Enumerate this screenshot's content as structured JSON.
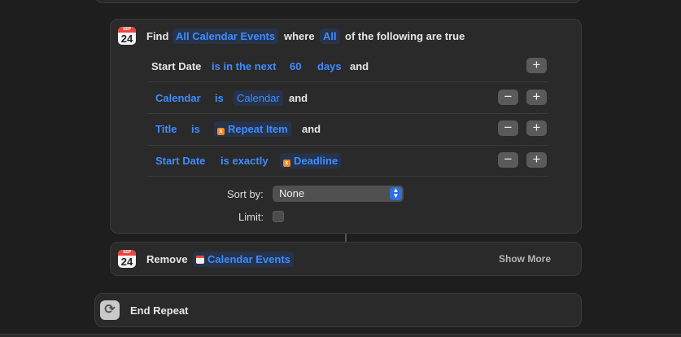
{
  "find_action": {
    "calendar_icon": {
      "month": "SEP",
      "day": "24"
    },
    "find_label": "Find",
    "source": "All Calendar Events",
    "where_label": "where",
    "match_mode": "All",
    "match_suffix": "of the following are true",
    "conditions": [
      {
        "field": "Start Date",
        "operator": "is in the next",
        "value": "60",
        "unit": "days",
        "joiner": "and"
      },
      {
        "field": "Calendar",
        "operator": "is",
        "value": "Calendar",
        "joiner": "and"
      },
      {
        "field": "Title",
        "operator": "is",
        "value": "Repeat Item",
        "value_icon": "variable-icon",
        "joiner": "and"
      },
      {
        "field": "Start Date",
        "operator": "is exactly",
        "value": "Deadline",
        "value_icon": "variable-icon"
      }
    ],
    "minus_symbol": "−",
    "plus_symbol": "+",
    "sort_by_label": "Sort by:",
    "sort_by_value": "None",
    "limit_label": "Limit:",
    "limit_checked": false
  },
  "remove_action": {
    "calendar_icon": {
      "month": "SEP",
      "day": "24"
    },
    "label": "Remove",
    "target": "Calendar Events",
    "target_icon": "calendar-icon",
    "show_more": "Show More"
  },
  "end_repeat": {
    "icon": "repeat-icon",
    "label": "End Repeat"
  },
  "colors": {
    "background": "#1e1e1e",
    "card": "#2a2a2a",
    "token_blue": "#3f8cff",
    "variable_orange": "#f08a24",
    "select_accent": "#2f6fe0"
  }
}
